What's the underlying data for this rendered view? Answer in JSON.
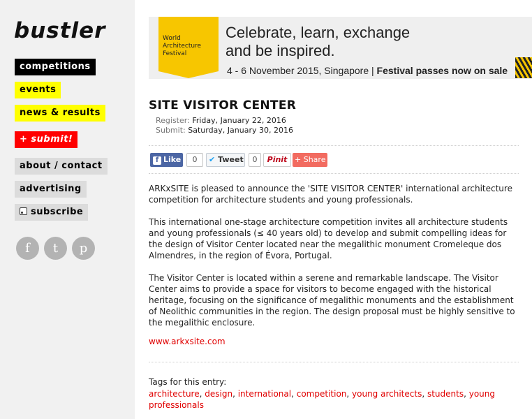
{
  "sidebar": {
    "logo": "bustler",
    "nav": {
      "competitions": "competitions",
      "events": "events",
      "news": "news & results",
      "submit": "+ submit!",
      "about": "about / contact",
      "advertising": "advertising",
      "subscribe": "subscribe"
    },
    "social": {
      "facebook": "f",
      "twitter": "t",
      "pinterest": "p"
    }
  },
  "banner": {
    "logo_text": "World\nArchitecture\nFestival",
    "headline_line1": "Celebrate, learn, exchange",
    "headline_line2": "and be inspired.",
    "date": "4 - 6 November 2015, Singapore |",
    "cta": "Festival passes now on sale"
  },
  "article": {
    "title": "SITE VISITOR CENTER",
    "register_label": "Register:",
    "register_date": "Friday, January 22, 2016",
    "submit_label": "Submit:",
    "submit_date": "Saturday, January 30, 2016",
    "share": {
      "like": "Like",
      "like_count": "0",
      "tweet": "Tweet",
      "tweet_count": "0",
      "pinit": "Pinit",
      "share": "Share"
    },
    "paragraphs": [
      "ARKxSITE is pleased to announce the 'SITE VISITOR CENTER' international architecture competition for architecture students and young professionals.",
      "This international one-stage architecture competition invites all architecture students and young professionals (≤ 40 years old) to develop and submit compelling ideas for the design of Visitor Center located near the megalithic monument Cromeleque dos Almendres, in the region of Évora, Portugal.",
      "The Visitor Center is located within a serene and remarkable landscape. The Visitor Center aims to provide a space for visitors to become engaged with the historical heritage, focusing on the significance of megalithic monuments and the establishment of Neolithic communities in the region. The design proposal must be highly sensitive to the megalithic enclosure."
    ],
    "website": "www.arkxsite.com",
    "tags_label": "Tags for this entry:",
    "tags": [
      "architecture",
      "design",
      "international",
      "competition",
      "young architects",
      "students",
      "young professionals"
    ]
  },
  "colors": {
    "accent_red": "#e00000",
    "nav_yellow": "#ffff00",
    "festival_yellow": "#f7c600"
  }
}
